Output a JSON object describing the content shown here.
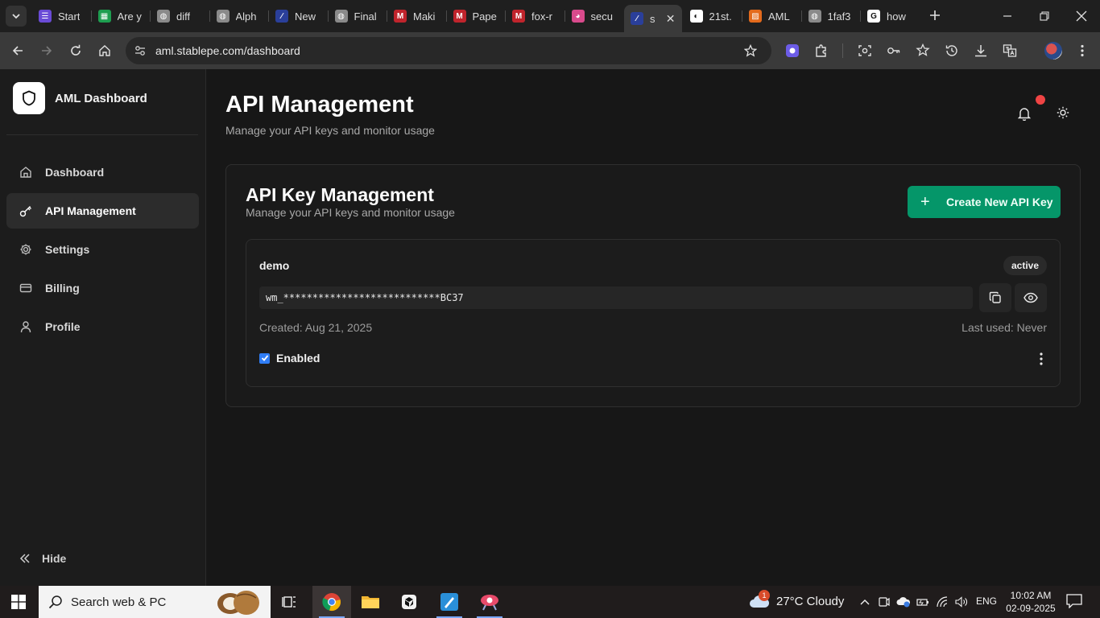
{
  "browser": {
    "tabs": [
      {
        "label": "Start",
        "favicon_color": "#6a4bd6",
        "favicon_glyph": "☰"
      },
      {
        "label": "Are y",
        "favicon_color": "#1e9e50",
        "favicon_glyph": "▦"
      },
      {
        "label": "diff",
        "favicon_color": "#8a8a8a",
        "favicon_glyph": "◍"
      },
      {
        "label": "Alph",
        "favicon_color": "#8a8a8a",
        "favicon_glyph": "◍"
      },
      {
        "label": "New",
        "favicon_color": "#2a3f9a",
        "favicon_glyph": "∕"
      },
      {
        "label": "Final",
        "favicon_color": "#8a8a8a",
        "favicon_glyph": "◍"
      },
      {
        "label": "Maki",
        "favicon_color": "#c0242c",
        "favicon_glyph": "M"
      },
      {
        "label": "Pape",
        "favicon_color": "#c0242c",
        "favicon_glyph": "M"
      },
      {
        "label": "fox-r",
        "favicon_color": "#c0242c",
        "favicon_glyph": "M"
      },
      {
        "label": "secu",
        "favicon_color": "#d94a8c",
        "favicon_glyph": "◕"
      },
      {
        "label": "s",
        "favicon_color": "#2a3f9a",
        "favicon_glyph": "∕"
      },
      {
        "label": "21st.",
        "favicon_color": "#ffffff",
        "favicon_glyph": "◐"
      },
      {
        "label": "AML",
        "favicon_color": "#e36a1c",
        "favicon_glyph": "▨"
      },
      {
        "label": "1faf3",
        "favicon_color": "#8a8a8a",
        "favicon_glyph": "◍"
      },
      {
        "label": "how",
        "favicon_color": "#ffffff",
        "favicon_glyph": "G"
      }
    ],
    "active_tab_index": 10,
    "url": "aml.stablepe.com/dashboard"
  },
  "sidebar": {
    "brand": "AML Dashboard",
    "items": [
      {
        "label": "Dashboard",
        "icon": "home-icon"
      },
      {
        "label": "API Management",
        "icon": "key-icon"
      },
      {
        "label": "Settings",
        "icon": "gear-icon"
      },
      {
        "label": "Billing",
        "icon": "credit-card-icon"
      },
      {
        "label": "Profile",
        "icon": "user-icon"
      }
    ],
    "active_index": 1,
    "hide_label": "Hide"
  },
  "header": {
    "title": "API Management",
    "subtitle": "Manage your API keys and monitor usage",
    "has_notification": true
  },
  "card": {
    "title": "API Key Management",
    "subtitle": "Manage your API keys and monitor usage",
    "create_label": "Create New API Key",
    "keys": [
      {
        "name": "demo",
        "status": "active",
        "value": "wm_***************************BC37",
        "created": "Created: Aug 21, 2025",
        "last_used": "Last used: Never",
        "enabled_label": "Enabled",
        "enabled": true
      }
    ]
  },
  "taskbar": {
    "search_placeholder": "Search web & PC",
    "weather": "27°C  Cloudy",
    "weather_badge": "1",
    "language": "ENG",
    "time": "10:02 AM",
    "date": "02-09-2025"
  },
  "colors": {
    "accent_green": "#059669",
    "checkbox_blue": "#2f7df6",
    "notification_red": "#ef4444"
  }
}
